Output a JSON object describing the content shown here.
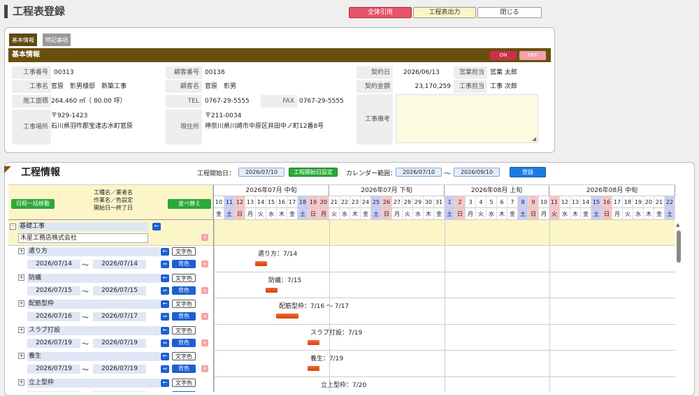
{
  "header": {
    "title": "工程表登録",
    "buttons": {
      "all_quote": "全体引用",
      "export": "工程表出力",
      "close": "閉じる"
    }
  },
  "basic": {
    "tabs": [
      "基本情報",
      "特記事項"
    ],
    "section_title": "基本情報",
    "toggle_on": "ON",
    "toggle_off": "OFF",
    "fields": {
      "job_no_label": "工事番号",
      "job_no": "00313",
      "customer_no_label": "顧客番号",
      "customer_no": "00138",
      "contract_date_label": "契約日",
      "contract_date": "2026/06/13",
      "sales_label": "営業担当",
      "sales": "営業 太郎",
      "job_name_label": "工事名",
      "job_name": "官原　彰男様邸　新築工事",
      "customer_name_label": "顧客名",
      "customer_name": "官原　彰男",
      "contract_amount_label": "契約金額",
      "contract_amount": "23,170,259",
      "engineer_label": "工事担当",
      "engineer": "工事 次郎",
      "floor_area_label": "施工面積",
      "floor_area": "264.460 ㎡（ 80.00 坪）",
      "tel_label": "TEL",
      "tel": "0767-29-5555",
      "fax_label": "FAX",
      "fax": "0767-29-5555",
      "site_label": "工事場所",
      "site_zip": "〒929-1423",
      "site_address": "石川県羽咋郡宝達志水町官原",
      "address_label": "現住所",
      "address_zip": "〒211-0034",
      "address": "神奈川県川崎市中原区井田中ノ町12番8号",
      "remarks_label": "工事備考"
    }
  },
  "schedule": {
    "title": "工程情報",
    "start_label": "工程開始日：",
    "start_date": "2026/07/10",
    "set_start_button": "工程開始日設定",
    "calendar_label": "カレンダー範囲：",
    "range_from": "2026/07/10",
    "range_sep": "～",
    "range_to": "2026/09/10",
    "register_button": "登録",
    "bulk_move_button": "日程一括移動",
    "sort_button": "並べ替え",
    "header_cols": [
      "工種名／業者名",
      "作業名／色設定",
      "開始日～終了日"
    ],
    "periods": [
      "2026年07月 中旬",
      "2026年07月 下旬",
      "2026年08月 上旬",
      "2026年08月 中旬"
    ],
    "days": [
      {
        "d": "10",
        "w": "金",
        "t": "n"
      },
      {
        "d": "11",
        "w": "土",
        "t": "sat"
      },
      {
        "d": "12",
        "w": "日",
        "t": "sun"
      },
      {
        "d": "13",
        "w": "月",
        "t": "n"
      },
      {
        "d": "14",
        "w": "火",
        "t": "n"
      },
      {
        "d": "15",
        "w": "水",
        "t": "n"
      },
      {
        "d": "16",
        "w": "木",
        "t": "n"
      },
      {
        "d": "17",
        "w": "金",
        "t": "n"
      },
      {
        "d": "18",
        "w": "土",
        "t": "sat"
      },
      {
        "d": "19",
        "w": "日",
        "t": "sun"
      },
      {
        "d": "20",
        "w": "月",
        "t": "sun"
      },
      {
        "d": "21",
        "w": "火",
        "t": "n"
      },
      {
        "d": "22",
        "w": "水",
        "t": "n"
      },
      {
        "d": "23",
        "w": "木",
        "t": "n"
      },
      {
        "d": "24",
        "w": "金",
        "t": "n"
      },
      {
        "d": "25",
        "w": "土",
        "t": "sat"
      },
      {
        "d": "26",
        "w": "日",
        "t": "sun"
      },
      {
        "d": "27",
        "w": "月",
        "t": "n"
      },
      {
        "d": "28",
        "w": "火",
        "t": "n"
      },
      {
        "d": "29",
        "w": "水",
        "t": "n"
      },
      {
        "d": "30",
        "w": "木",
        "t": "n"
      },
      {
        "d": "31",
        "w": "金",
        "t": "n"
      },
      {
        "d": "1",
        "w": "土",
        "t": "sat"
      },
      {
        "d": "2",
        "w": "日",
        "t": "sun"
      },
      {
        "d": "3",
        "w": "月",
        "t": "n"
      },
      {
        "d": "4",
        "w": "火",
        "t": "n"
      },
      {
        "d": "5",
        "w": "水",
        "t": "n"
      },
      {
        "d": "6",
        "w": "木",
        "t": "n"
      },
      {
        "d": "7",
        "w": "金",
        "t": "n"
      },
      {
        "d": "8",
        "w": "土",
        "t": "sat"
      },
      {
        "d": "9",
        "w": "日",
        "t": "sun"
      },
      {
        "d": "10",
        "w": "月",
        "t": "n"
      },
      {
        "d": "11",
        "w": "火",
        "t": "sun"
      },
      {
        "d": "12",
        "w": "水",
        "t": "n"
      },
      {
        "d": "13",
        "w": "木",
        "t": "n"
      },
      {
        "d": "14",
        "w": "金",
        "t": "n"
      },
      {
        "d": "15",
        "w": "土",
        "t": "sat"
      },
      {
        "d": "16",
        "w": "日",
        "t": "sun"
      },
      {
        "d": "17",
        "w": "月",
        "t": "n"
      },
      {
        "d": "18",
        "w": "火",
        "t": "n"
      },
      {
        "d": "19",
        "w": "水",
        "t": "n"
      },
      {
        "d": "20",
        "w": "木",
        "t": "n"
      },
      {
        "d": "21",
        "w": "金",
        "t": "n"
      },
      {
        "d": "22",
        "w": "土",
        "t": "sat"
      }
    ],
    "group": {
      "name": "基礎工事",
      "vendor": "木星工務店株式会社"
    },
    "text_color_chip": "文字色",
    "bg_color_chip": "背色",
    "tilde": "～",
    "tasks": [
      {
        "name": "遣り方",
        "start": "2026/07/14",
        "end": "2026/07/14",
        "bar_label": "遣り方：7/14",
        "s": 4,
        "e": 4
      },
      {
        "name": "防蟻",
        "start": "2026/07/15",
        "end": "2026/07/15",
        "bar_label": "防蟻：7/15",
        "s": 5,
        "e": 5
      },
      {
        "name": "配筋型枠",
        "start": "2026/07/16",
        "end": "2026/07/17",
        "bar_label": "配筋型枠：7/16 ～ 7/17",
        "s": 6,
        "e": 7
      },
      {
        "name": "スラブ打設",
        "start": "2026/07/19",
        "end": "2026/07/19",
        "bar_label": "スラブ打設：7/19",
        "s": 9,
        "e": 9
      },
      {
        "name": "養生",
        "start": "2026/07/19",
        "end": "2026/07/19",
        "bar_label": "養生：7/19",
        "s": 9,
        "e": 9
      },
      {
        "name": "立上型枠",
        "start": "",
        "end": "",
        "bar_label": "立上型枠：7/20",
        "s": 10,
        "e": 10
      }
    ]
  }
}
